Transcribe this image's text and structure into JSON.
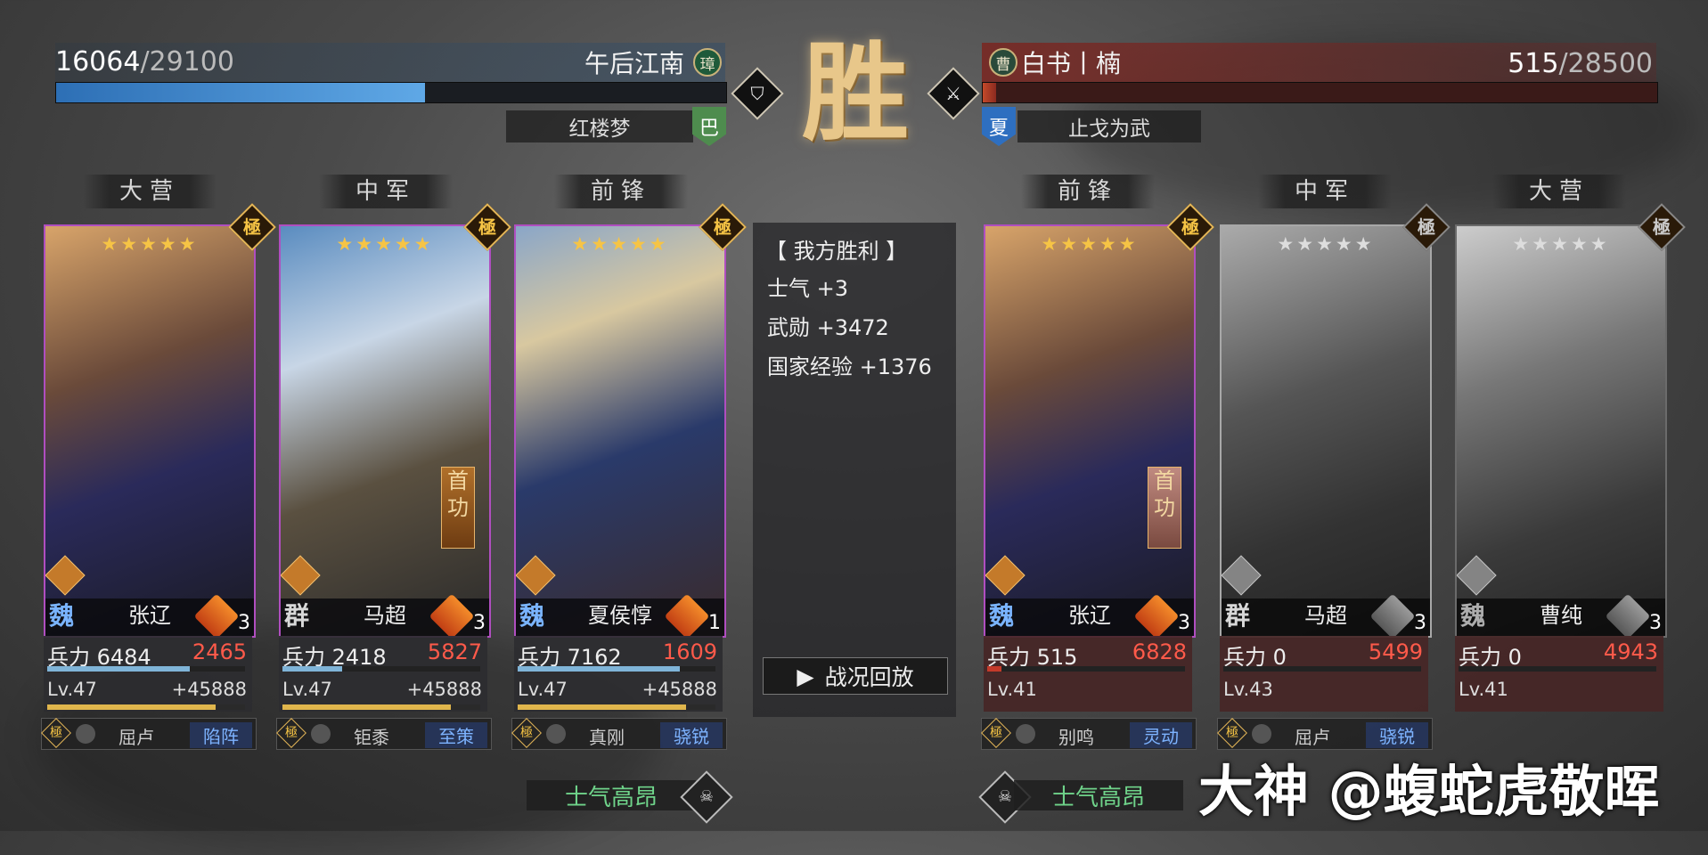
{
  "result": "胜",
  "left_team": {
    "hp_current": "16064",
    "hp_total": "/29100",
    "hp_fraction": 0.55,
    "name": "午后江南",
    "emblem": "璋",
    "sub_name": "红楼梦",
    "sub_badge": "巴"
  },
  "right_team": {
    "hp_current": "515",
    "hp_total": "/28500",
    "hp_fraction": 0.02,
    "name": "白书丨楠",
    "emblem": "曹",
    "sub_name": "止戈为武",
    "sub_badge": "夏"
  },
  "left_positions": [
    "大营",
    "中军",
    "前锋"
  ],
  "right_positions": [
    "前锋",
    "中军",
    "大营"
  ],
  "left_heroes": [
    {
      "faction": "魏",
      "name": "张辽",
      "horse_level": "3",
      "stars": "★★★★★",
      "rank_badge": "極",
      "troops": "兵力 6484",
      "loss": "2465",
      "level": "Lv.47",
      "exp": "+45888",
      "skill_1": "屈卢",
      "skill_2": "陷阵",
      "troop_fraction": 0.72,
      "exp_fraction": 0.85
    },
    {
      "faction": "群",
      "name": "马超",
      "horse_level": "3",
      "stars": "★★★★★",
      "rank_badge": "極",
      "troops": "兵力 2418",
      "loss": "5827",
      "level": "Lv.47",
      "exp": "+45888",
      "skill_1": "钜黍",
      "skill_2": "至策",
      "tag": "首功",
      "troop_fraction": 0.3,
      "exp_fraction": 0.85
    },
    {
      "faction": "魏",
      "name": "夏侯惇",
      "horse_level": "1",
      "stars": "★★★★★",
      "rank_badge": "極",
      "troops": "兵力 7162",
      "loss": "1609",
      "level": "Lv.47",
      "exp": "+45888",
      "skill_1": "真刚",
      "skill_2": "骁锐",
      "troop_fraction": 0.82,
      "exp_fraction": 0.85
    }
  ],
  "right_heroes": [
    {
      "faction": "魏",
      "name": "张辽",
      "horse_level": "3",
      "stars": "★★★★★",
      "rank_badge": "極",
      "troops": "兵力 515",
      "loss": "6828",
      "level": "Lv.41",
      "skill_1": "别鸣",
      "skill_2": "灵动",
      "tag": "首功",
      "troop_fraction": 0.07
    },
    {
      "faction": "群",
      "name": "马超",
      "horse_level": "3",
      "stars": "★★★★★",
      "rank_badge": "極",
      "troops": "兵力 0",
      "loss": "5499",
      "level": "Lv.43",
      "skill_1": "屈卢",
      "skill_2": "骁锐",
      "troop_fraction": 0
    },
    {
      "faction": "魏",
      "name": "曹纯",
      "horse_level": "3",
      "stars": "★★★★★",
      "rank_badge": "極",
      "troops": "兵力 0",
      "loss": "4943",
      "level": "Lv.41",
      "skill_1": "",
      "skill_2": "",
      "troop_fraction": 0
    }
  ],
  "rewards": {
    "title": "【 我方胜利 】",
    "lines": [
      "士气 +3",
      "武勋 +3472",
      "国家经验 +1376"
    ]
  },
  "replay_button": "战况回放",
  "morale_left": "士气高昂",
  "morale_right": "士气高昂",
  "watermark": "大神 @蝮蛇虎敬晖",
  "colors": {
    "ally_bar": "#4a8fd0",
    "enemy_bar": "#b8442a",
    "card_border": "#b04ec0",
    "loss_red": "#ff5a4a",
    "morale_green": "#6fd38a"
  }
}
